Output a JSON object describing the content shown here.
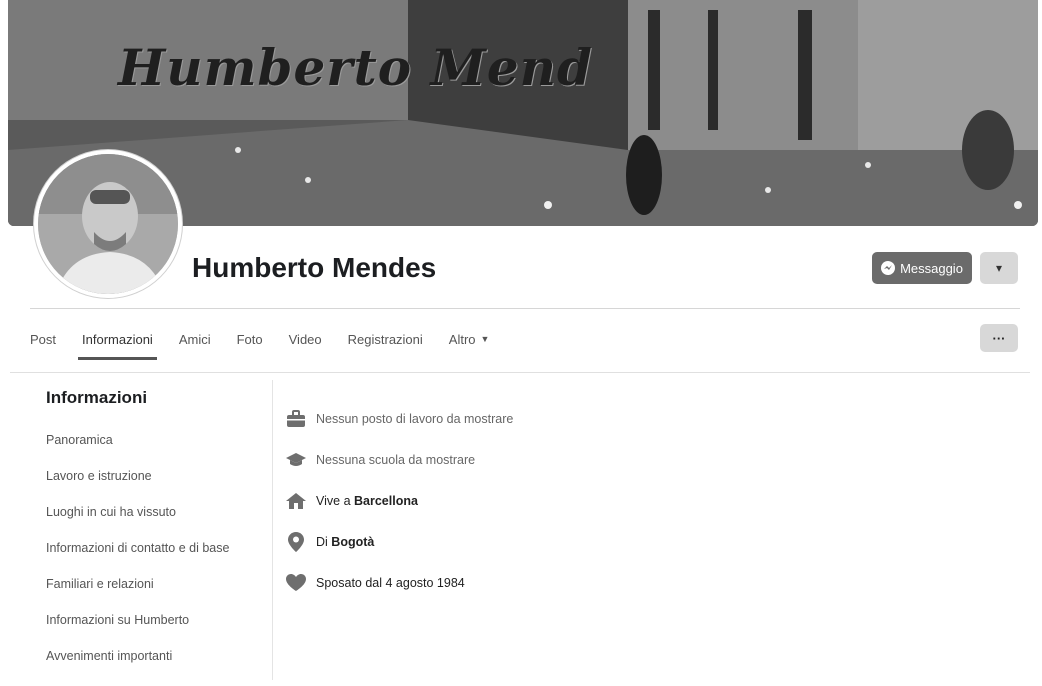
{
  "profile": {
    "cover_text": "Humberto Mend",
    "name": "Humberto Mendes",
    "message_button": "Messaggio",
    "more_button": "▾"
  },
  "tabs": [
    {
      "label": "Post"
    },
    {
      "label": "Informazioni",
      "active": true
    },
    {
      "label": "Amici"
    },
    {
      "label": "Foto"
    },
    {
      "label": "Video"
    },
    {
      "label": "Registrazioni"
    },
    {
      "label": "Altro",
      "caret": "▼"
    }
  ],
  "tabs_more": "···",
  "sidebar": {
    "title": "Informazioni",
    "items": [
      {
        "label": "Panoramica"
      },
      {
        "label": "Lavoro e istruzione"
      },
      {
        "label": "Luoghi in cui ha vissuto"
      },
      {
        "label": "Informazioni di contatto e di base"
      },
      {
        "label": "Familiari e relazioni"
      },
      {
        "label": "Informazioni su Humberto"
      },
      {
        "label": "Avvenimenti importanti"
      }
    ]
  },
  "info": {
    "work": "Nessun posto di lavoro da mostrare",
    "school": "Nessuna scuola da mostrare",
    "lives_prefix": "Vive a",
    "lives_place": "Barcellona",
    "from_prefix": "Di",
    "from_place": "Bogotà",
    "relationship": "Sposato dal 4 agosto 1984"
  },
  "icons": {
    "work": "briefcase-icon",
    "school": "graduation-cap-icon",
    "lives": "house-icon",
    "from": "location-pin-icon",
    "relationship": "heart-icon",
    "message": "messenger-icon"
  },
  "colors": {
    "button_dark": "#6b6b6b",
    "button_light": "#d8d8d8",
    "icon_gray": "#6e6e6e"
  }
}
